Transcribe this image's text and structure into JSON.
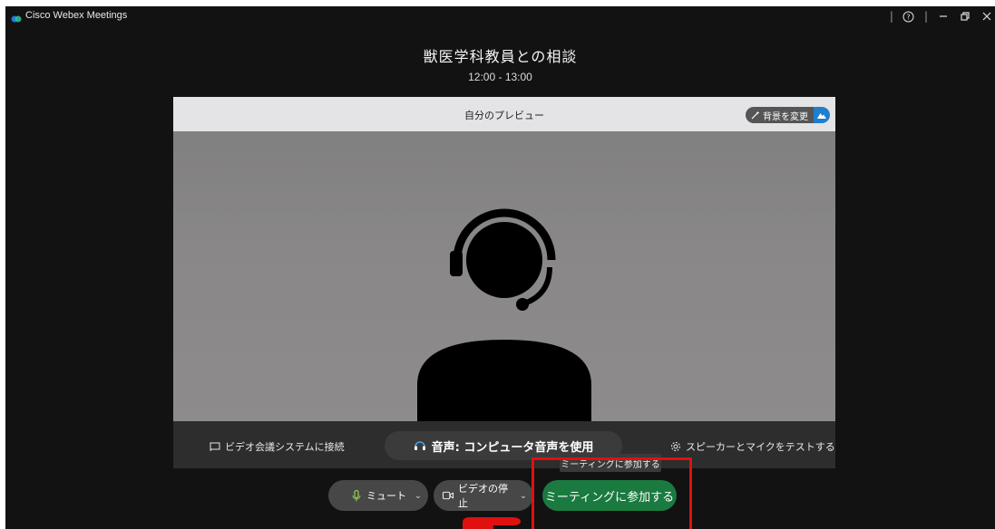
{
  "window": {
    "app_title": "Cisco Webex Meetings",
    "help_label": "?",
    "brand_color": "#1f7ecf"
  },
  "meeting": {
    "title": "獣医学科教員との相談",
    "time": "12:00 - 13:00"
  },
  "preview": {
    "title": "自分のプレビュー",
    "background_button": "背景を変更",
    "avatar_icon": "headset-user-icon"
  },
  "footer": {
    "connect_device": "ビデオ会議システムに接続",
    "audio_label": "音声: コンピュータ音声を使用",
    "test_audio": "スピーカーとマイクをテストする"
  },
  "tooltip": "ミーティングに参加する",
  "controls": {
    "mute": "ミュート",
    "stop_video": "ビデオの停止",
    "join": "ミーティングに参加する",
    "join_color": "#1a7a3f"
  },
  "annotation": {
    "highlight_color": "#e01010"
  }
}
